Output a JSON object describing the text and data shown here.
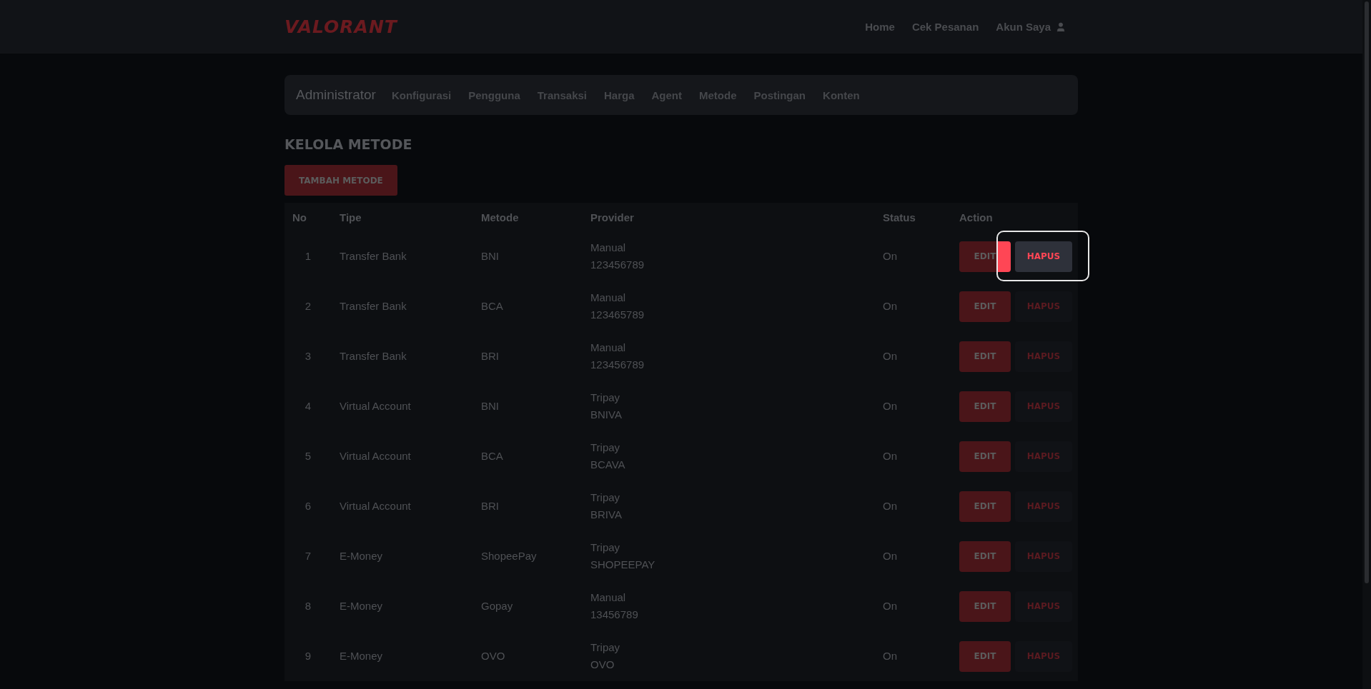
{
  "navbar": {
    "logo": "VALORANT",
    "links": [
      {
        "label": "Home",
        "kind": "text"
      },
      {
        "label": "Cek Pesanan",
        "kind": "text"
      },
      {
        "label": "Akun Saya",
        "kind": "account"
      }
    ]
  },
  "admin_nav": {
    "title": "Administrator",
    "items": [
      {
        "label": "Konfigurasi"
      },
      {
        "label": "Pengguna"
      },
      {
        "label": "Transaksi"
      },
      {
        "label": "Harga"
      },
      {
        "label": "Agent"
      },
      {
        "label": "Metode"
      },
      {
        "label": "Postingan"
      },
      {
        "label": "Konten"
      }
    ]
  },
  "page_title": "KELOLA METODE",
  "add_button": "TAMBAH METODE",
  "table": {
    "columns": [
      "No",
      "Tipe",
      "Metode",
      "Provider",
      "Status",
      "Action"
    ],
    "rows": [
      {
        "no": "1",
        "tipe": "Transfer Bank",
        "metode": "BNI",
        "provider": [
          "Manual",
          "123456789"
        ],
        "status": "On",
        "edit": "EDIT",
        "delete": "HAPUS",
        "highlighted": true
      },
      {
        "no": "2",
        "tipe": "Transfer Bank",
        "metode": "BCA",
        "provider": [
          "Manual",
          "123465789"
        ],
        "status": "On",
        "edit": "EDIT",
        "delete": "HAPUS",
        "highlighted": false
      },
      {
        "no": "3",
        "tipe": "Transfer Bank",
        "metode": "BRI",
        "provider": [
          "Manual",
          "123456789"
        ],
        "status": "On",
        "edit": "EDIT",
        "delete": "HAPUS",
        "highlighted": false
      },
      {
        "no": "4",
        "tipe": "Virtual Account",
        "metode": "BNI",
        "provider": [
          "Tripay",
          "BNIVA"
        ],
        "status": "On",
        "edit": "EDIT",
        "delete": "HAPUS",
        "highlighted": false
      },
      {
        "no": "5",
        "tipe": "Virtual Account",
        "metode": "BCA",
        "provider": [
          "Tripay",
          "BCAVA"
        ],
        "status": "On",
        "edit": "EDIT",
        "delete": "HAPUS",
        "highlighted": false
      },
      {
        "no": "6",
        "tipe": "Virtual Account",
        "metode": "BRI",
        "provider": [
          "Tripay",
          "BRIVA"
        ],
        "status": "On",
        "edit": "EDIT",
        "delete": "HAPUS",
        "highlighted": false
      },
      {
        "no": "7",
        "tipe": "E-Money",
        "metode": "ShopeePay",
        "provider": [
          "Tripay",
          "SHOPEEPAY"
        ],
        "status": "On",
        "edit": "EDIT",
        "delete": "HAPUS",
        "highlighted": false
      },
      {
        "no": "8",
        "tipe": "E-Money",
        "metode": "Gopay",
        "provider": [
          "Manual",
          "13456789"
        ],
        "status": "On",
        "edit": "EDIT",
        "delete": "HAPUS",
        "highlighted": false
      },
      {
        "no": "9",
        "tipe": "E-Money",
        "metode": "OVO",
        "provider": [
          "Tripay",
          "OVO"
        ],
        "status": "On",
        "edit": "EDIT",
        "delete": "HAPUS",
        "highlighted": false
      }
    ]
  }
}
